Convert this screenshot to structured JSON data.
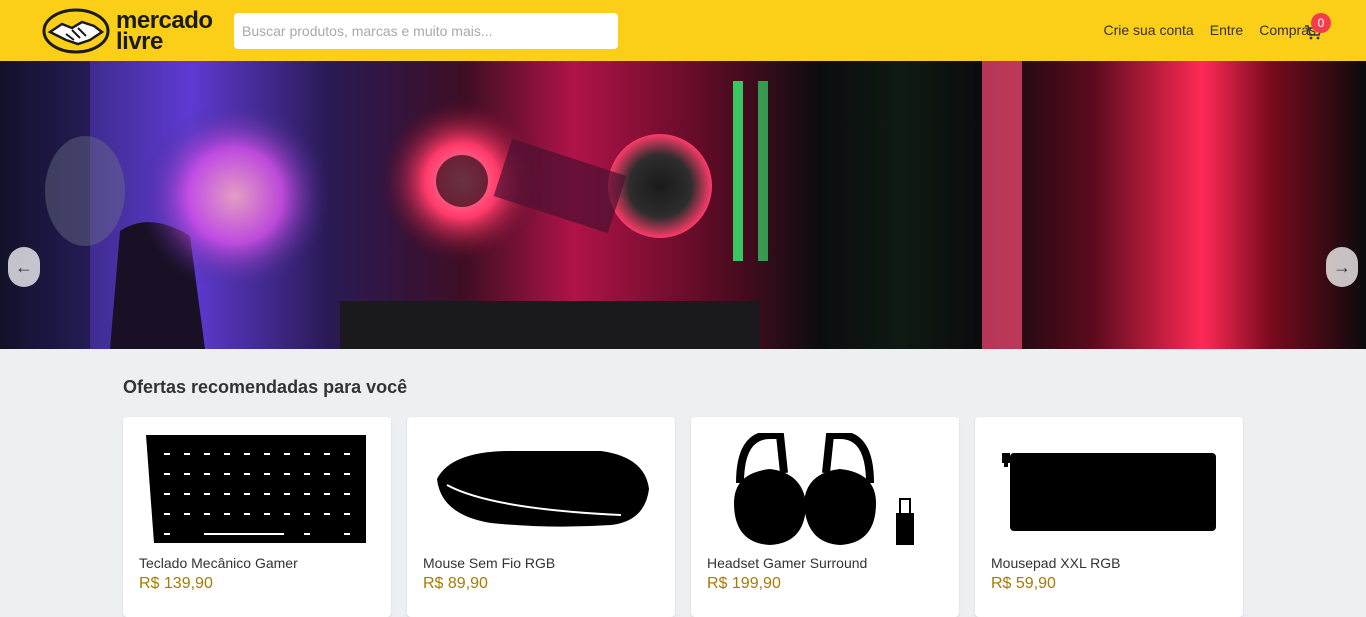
{
  "header": {
    "logo_top": "mercado",
    "logo_bottom": "livre",
    "search_placeholder": "Buscar produtos, marcas e muito mais...",
    "nav": [
      "Crie sua conta",
      "Entre",
      "Compras"
    ],
    "cart_count": "0"
  },
  "hero": {
    "prev_label": "←",
    "next_label": "→"
  },
  "section": {
    "title": "Ofertas recomendadas para você",
    "products": [
      {
        "name": "Teclado Mecânico Gamer",
        "price": "R$ 139,90",
        "icon": "keyboard-icon"
      },
      {
        "name": "Mouse Sem Fio RGB",
        "price": "R$ 89,90",
        "icon": "mouse-icon"
      },
      {
        "name": "Headset Gamer Surround",
        "price": "R$ 199,90",
        "icon": "headset-icon"
      },
      {
        "name": "Mousepad XXL RGB",
        "price": "R$ 59,90",
        "icon": "mousepad-icon"
      }
    ]
  },
  "colors": {
    "brand": "#fbcf17",
    "badge": "#f23d4f",
    "price": "#a47c00"
  }
}
